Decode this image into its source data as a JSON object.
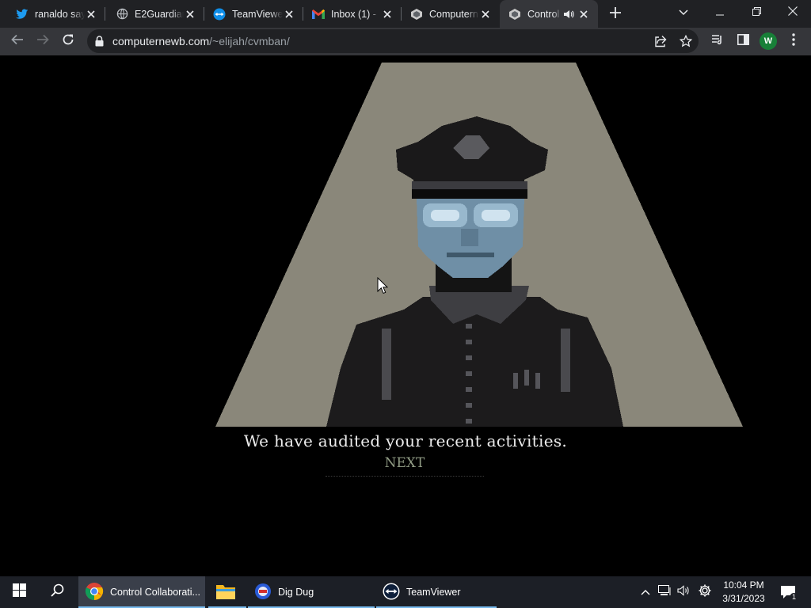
{
  "browser": {
    "tabs": [
      {
        "title": "ranaldo say",
        "icon": "twitter-icon"
      },
      {
        "title": "E2Guardian",
        "icon": "globe-icon"
      },
      {
        "title": "TeamViewer",
        "icon": "teamviewer-icon"
      },
      {
        "title": "Inbox (1) -",
        "icon": "gmail-icon"
      },
      {
        "title": "Computern",
        "icon": "site-icon"
      },
      {
        "title": "Control",
        "icon": "site-icon",
        "active": true,
        "audio": true
      }
    ],
    "address": {
      "domain": "computernewb.com",
      "path": "/~elijah/cvmban/"
    },
    "profile_initial": "W"
  },
  "game": {
    "dialog_text": "We have audited your recent activities.",
    "next_label": "NEXT"
  },
  "taskbar": {
    "apps": [
      {
        "label": "Control Collaborati...",
        "icon": "chrome-icon",
        "active": true
      },
      {
        "label": "",
        "icon": "file-explorer-icon"
      },
      {
        "label": "Dig Dug",
        "icon": "dig-dug-icon"
      },
      {
        "label": "TeamViewer",
        "icon": "teamviewer-icon"
      }
    ],
    "clock": {
      "time": "10:04 PM",
      "date": "3/31/2023"
    },
    "notification_count": "1"
  },
  "colors": {
    "spotlight": "#8a877a",
    "face": "#6f8fa6",
    "uniform": "#1c1b1c",
    "next_text": "#8f9a83"
  }
}
